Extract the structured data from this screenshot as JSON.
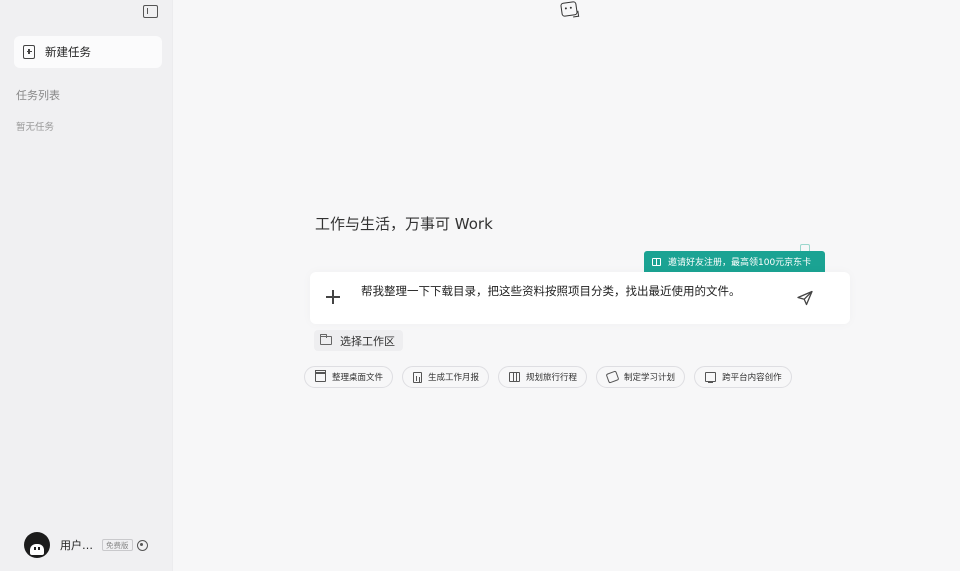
{
  "sidebar": {
    "new_task_label": "新建任务",
    "task_list_title": "任务列表",
    "task_empty_text": "暂无任务",
    "user": {
      "name": "用户…",
      "plan_badge": "免费版"
    }
  },
  "main": {
    "headline": "工作与生活，万事可 Work",
    "promo_text": "邀请好友注册，最高领100元京东卡",
    "input": {
      "value": "帮我整理一下下载目录，把这些资料按照项目分类，找出最近使用的文件。"
    },
    "workspace_label": "选择工作区",
    "suggestions": [
      {
        "label": "整理桌面文件",
        "icon": "archive-box-icon"
      },
      {
        "label": "生成工作月报",
        "icon": "calculator-icon"
      },
      {
        "label": "规划旅行行程",
        "icon": "map-icon"
      },
      {
        "label": "制定学习计划",
        "icon": "pen-icon"
      },
      {
        "label": "跨平台内容创作",
        "icon": "monitor-icon"
      }
    ]
  },
  "colors": {
    "accent_teal": "#1ba393",
    "sidebar_bg": "#f0f0f2",
    "main_bg": "#f7f7f8"
  },
  "icons": {
    "sidebar_toggle": "sidebar-toggle-icon",
    "top_logo": "app-logo-icon",
    "send": "send-icon",
    "add": "plus-icon",
    "folder": "folder-icon",
    "gift": "gift-icon",
    "settings": "gear-icon"
  }
}
